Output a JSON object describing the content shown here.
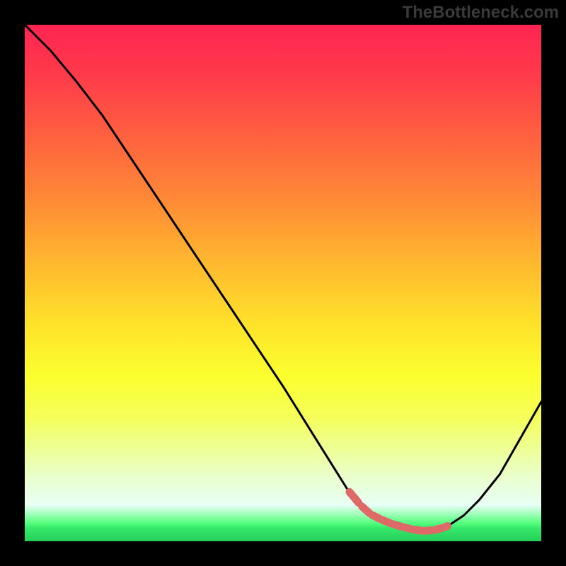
{
  "watermark": "TheBottleneck.com",
  "colors": {
    "frame": "#000000",
    "curve_stroke": "#000000",
    "marker_stroke": "#dd6a66",
    "gradient_top": "#ff2452",
    "gradient_bottom": "#25cf58"
  },
  "chart_data": {
    "type": "line",
    "title": "",
    "xlabel": "",
    "ylabel": "",
    "xlim": [
      0,
      100
    ],
    "ylim": [
      0,
      100
    ],
    "series": [
      {
        "name": "bottleneck-curve",
        "x": [
          0,
          5,
          10,
          15,
          20,
          25,
          30,
          35,
          40,
          45,
          50,
          55,
          60,
          62.5,
          65,
          70,
          75,
          77,
          80,
          82,
          85,
          88,
          92,
          96,
          100
        ],
        "y": [
          100,
          95,
          89,
          82.5,
          75,
          67.5,
          60,
          52.5,
          45,
          37.5,
          30,
          22,
          14,
          10,
          7,
          3.5,
          2,
          2,
          2.3,
          3,
          5,
          8,
          13,
          20,
          27
        ]
      }
    ],
    "highlight_segment": {
      "name": "valley-markers",
      "x": [
        62.5,
        65,
        67,
        69,
        71,
        73,
        75,
        77,
        79,
        81,
        82
      ],
      "y": [
        10,
        7,
        5.2,
        4.2,
        3.4,
        2.8,
        2.3,
        2,
        2.1,
        2.6,
        3
      ]
    }
  }
}
